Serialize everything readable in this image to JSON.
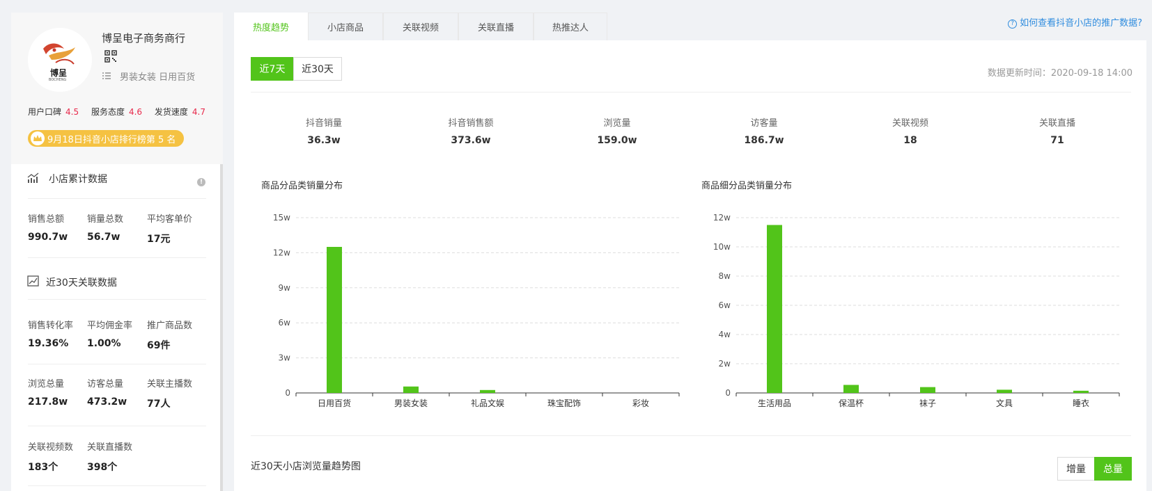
{
  "shop": {
    "name": "博呈电子商务商行",
    "logo_text": "博呈",
    "logo_subtext": "BOCHENG",
    "categories": "男装女装 日用百货",
    "ratings": [
      {
        "label": "用户口碑",
        "value": "4.5"
      },
      {
        "label": "服务态度",
        "value": "4.6"
      },
      {
        "label": "发货速度",
        "value": "4.7"
      }
    ],
    "rank_badge": "9月18日抖音小店排行榜第 5 名"
  },
  "cumulative": {
    "title": "小店累计数据",
    "stats": [
      {
        "label": "销售总额",
        "value": "990.7w"
      },
      {
        "label": "销量总数",
        "value": "56.7w"
      },
      {
        "label": "平均客单价",
        "value": "17元"
      }
    ]
  },
  "recent30": {
    "title": "近30天关联数据",
    "stats": [
      {
        "label": "销售转化率",
        "value": "19.36%"
      },
      {
        "label": "平均佣金率",
        "value": "1.00%"
      },
      {
        "label": "推广商品数",
        "value": "69件"
      },
      {
        "label": "浏览总量",
        "value": "217.8w"
      },
      {
        "label": "访客总量",
        "value": "473.2w"
      },
      {
        "label": "关联主播数",
        "value": "77人"
      },
      {
        "label": "关联视频数",
        "value": "183个"
      },
      {
        "label": "关联直播数",
        "value": "398个"
      }
    ]
  },
  "tabs": [
    "热度趋势",
    "小店商品",
    "关联视频",
    "关联直播",
    "热推达人"
  ],
  "help_link": "如何查看抖音小店的推广数据?",
  "range_buttons": [
    "近7天",
    "近30天"
  ],
  "update_time": "数据更新时间：2020-09-18 14:00",
  "kpis": [
    {
      "label": "抖音销量",
      "value": "36.3w"
    },
    {
      "label": "抖音销售额",
      "value": "373.6w"
    },
    {
      "label": "浏览量",
      "value": "159.0w"
    },
    {
      "label": "访客量",
      "value": "186.7w"
    },
    {
      "label": "关联视频",
      "value": "18"
    },
    {
      "label": "关联直播",
      "value": "71"
    }
  ],
  "trend": {
    "title": "近30天小店浏览量趋势图",
    "toggle": [
      "增量",
      "总量"
    ]
  },
  "colors": {
    "accent": "#52c41a",
    "rating": "#e8294b",
    "badge": "#f5c242",
    "link": "#2f8cde"
  },
  "chart_data": [
    {
      "type": "bar",
      "title": "商品分品类销量分布",
      "categories": [
        "日用百货",
        "男装女装",
        "礼品文娱",
        "珠宝配饰",
        "彩妆"
      ],
      "values": [
        12.5,
        0.55,
        0.25,
        0,
        0
      ],
      "ylim": [
        0,
        15
      ],
      "yticks": [
        0,
        3,
        6,
        9,
        12,
        15
      ],
      "ytick_labels": [
        "0",
        "3w",
        "6w",
        "9w",
        "12w",
        "15w"
      ],
      "grid": true
    },
    {
      "type": "bar",
      "title": "商品细分品类销量分布",
      "categories": [
        "生活用品",
        "保温杯",
        "袜子",
        "文具",
        "睡衣"
      ],
      "values": [
        11.5,
        0.55,
        0.4,
        0.22,
        0.15
      ],
      "ylim": [
        0,
        12
      ],
      "yticks": [
        0,
        2,
        4,
        6,
        8,
        10,
        12
      ],
      "ytick_labels": [
        "0",
        "2w",
        "4w",
        "6w",
        "8w",
        "10w",
        "12w"
      ],
      "grid": true
    }
  ]
}
